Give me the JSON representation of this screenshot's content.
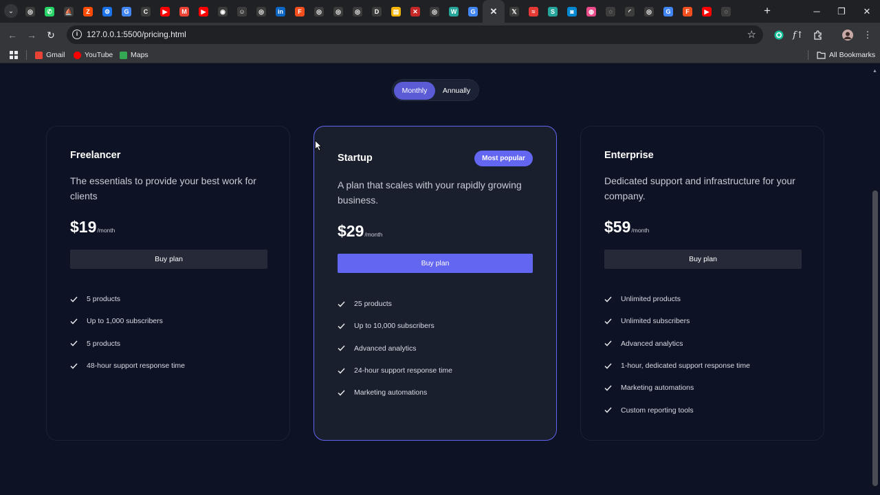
{
  "browser": {
    "url": "127.0.0.1:5500/pricing.html",
    "tab_favicons": [
      {
        "icon": "openai-icon",
        "color": "#3c3c3c",
        "glyph": "◎"
      },
      {
        "icon": "whatsapp-icon",
        "color": "#25d366",
        "glyph": "✆"
      },
      {
        "icon": "midjourney-icon",
        "color": "#3c3c3c",
        "glyph": "⛵"
      },
      {
        "icon": "zapier-icon",
        "color": "#ff4a00",
        "glyph": "Z"
      },
      {
        "icon": "gear-site-icon",
        "color": "#1a73e8",
        "glyph": "⚙"
      },
      {
        "icon": "google-icon",
        "color": "#4285f4",
        "glyph": "G"
      },
      {
        "icon": "c-site-icon",
        "color": "#3c3c3c",
        "glyph": "C"
      },
      {
        "icon": "youtube-icon",
        "color": "#ff0000",
        "glyph": "▶"
      },
      {
        "icon": "gmail-icon",
        "color": "#ea4335",
        "glyph": "M"
      },
      {
        "icon": "youtube-icon",
        "color": "#ff0000",
        "glyph": "▶"
      },
      {
        "icon": "circle-site-icon",
        "color": "#3c3c3c",
        "glyph": "◉"
      },
      {
        "icon": "smiley-site-icon",
        "color": "#3c3c3c",
        "glyph": "☺"
      },
      {
        "icon": "openai-icon",
        "color": "#3c3c3c",
        "glyph": "◎"
      },
      {
        "icon": "linkedin-icon",
        "color": "#0a66c2",
        "glyph": "in"
      },
      {
        "icon": "figma-icon",
        "color": "#f24e1e",
        "glyph": "F"
      },
      {
        "icon": "openai-icon",
        "color": "#3c3c3c",
        "glyph": "◎"
      },
      {
        "icon": "openai-icon",
        "color": "#3c3c3c",
        "glyph": "◎"
      },
      {
        "icon": "openai-icon",
        "color": "#3c3c3c",
        "glyph": "◎"
      },
      {
        "icon": "d-site-icon",
        "color": "#3c3c3c",
        "glyph": "D"
      },
      {
        "icon": "yellow-site-icon",
        "color": "#f4b400",
        "glyph": "▤"
      },
      {
        "icon": "x-red-site-icon",
        "color": "#c62828",
        "glyph": "✕"
      },
      {
        "icon": "openai-icon",
        "color": "#3c3c3c",
        "glyph": "◎"
      },
      {
        "icon": "w-site-icon",
        "color": "#26a69a",
        "glyph": "W"
      },
      {
        "icon": "google-icon",
        "color": "#4285f4",
        "glyph": "G"
      },
      {
        "icon": "active-tab-close-icon",
        "color": "#35363a",
        "glyph": "✕"
      },
      {
        "icon": "x-twitter-icon",
        "color": "#3c3c3c",
        "glyph": "𝕏"
      },
      {
        "icon": "red-swoosh-site-icon",
        "color": "#e53935",
        "glyph": "≈"
      },
      {
        "icon": "s-site-icon",
        "color": "#26a69a",
        "glyph": "S"
      },
      {
        "icon": "camera-site-icon",
        "color": "#0288d1",
        "glyph": "◙"
      },
      {
        "icon": "dribbble-icon",
        "color": "#ea4c89",
        "glyph": "◍"
      },
      {
        "icon": "globe-icon",
        "color": "#3c3c3c",
        "glyph": "◌"
      },
      {
        "icon": "loading-icon",
        "color": "#3c3c3c",
        "glyph": "◜"
      },
      {
        "icon": "circle-red-site-icon",
        "color": "#3c3c3c",
        "glyph": "◎"
      },
      {
        "icon": "google-icon",
        "color": "#4285f4",
        "glyph": "G"
      },
      {
        "icon": "figma-icon",
        "color": "#f24e1e",
        "glyph": "F"
      },
      {
        "icon": "youtube-icon",
        "color": "#ff0000",
        "glyph": "▶"
      },
      {
        "icon": "globe-icon",
        "color": "#3c3c3c",
        "glyph": "◌"
      }
    ],
    "bookmarks": [
      {
        "label": "Gmail",
        "color": "#ea4335"
      },
      {
        "label": "YouTube",
        "color": "#ff0000"
      },
      {
        "label": "Maps",
        "color": "#34a853"
      }
    ],
    "all_bookmarks_label": "All Bookmarks"
  },
  "billing_toggle": {
    "monthly": "Monthly",
    "annually": "Annually",
    "selected": "Monthly"
  },
  "plans": [
    {
      "name": "Freelancer",
      "description": "The essentials to provide your best work for clients",
      "price": "$19",
      "period": "/month",
      "button": "Buy plan",
      "featured": false,
      "features": [
        "5 products",
        "Up to 1,000 subscribers",
        "5 products",
        "48-hour support response time"
      ]
    },
    {
      "name": "Startup",
      "badge": "Most popular",
      "description": "A plan that scales with your rapidly growing business.",
      "price": "$29",
      "period": "/month",
      "button": "Buy plan",
      "featured": true,
      "features": [
        "25 products",
        "Up to 10,000 subscribers",
        "Advanced analytics",
        "24-hour support response time",
        "Marketing automations"
      ]
    },
    {
      "name": "Enterprise",
      "description": "Dedicated support and infrastructure for your company.",
      "price": "$59",
      "period": "/month",
      "button": "Buy plan",
      "featured": false,
      "features": [
        "Unlimited products",
        "Unlimited subscribers",
        "Advanced analytics",
        "1-hour, dedicated support response time",
        "Marketing automations",
        "Custom reporting tools"
      ]
    }
  ],
  "colors": {
    "page_bg": "#0d1224",
    "accent": "#6366f1",
    "featured_card_bg": "#1a1f2e",
    "button_bg": "#262a38"
  }
}
